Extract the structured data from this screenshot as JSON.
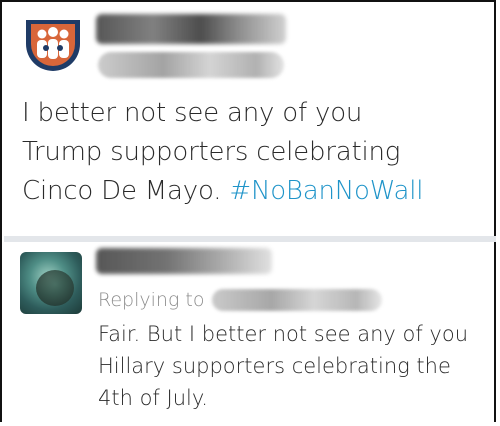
{
  "original_tweet": {
    "text_lines": [
      "I better not see any of you",
      "Trump supporters celebrating",
      "Cinco De Mayo."
    ],
    "hashtag": "#NoBanNoWall",
    "avatar_icon": "people-group-logo-icon",
    "colors": {
      "hashtag": "#1f94c9",
      "logo_orange": "#d8663a",
      "logo_navy": "#1f3b66"
    }
  },
  "reply_tweet": {
    "replying_label": "Replying to",
    "text_lines": [
      "Fair. But I better not see any of you",
      "Hillary supporters celebrating the",
      "4th of July."
    ]
  }
}
